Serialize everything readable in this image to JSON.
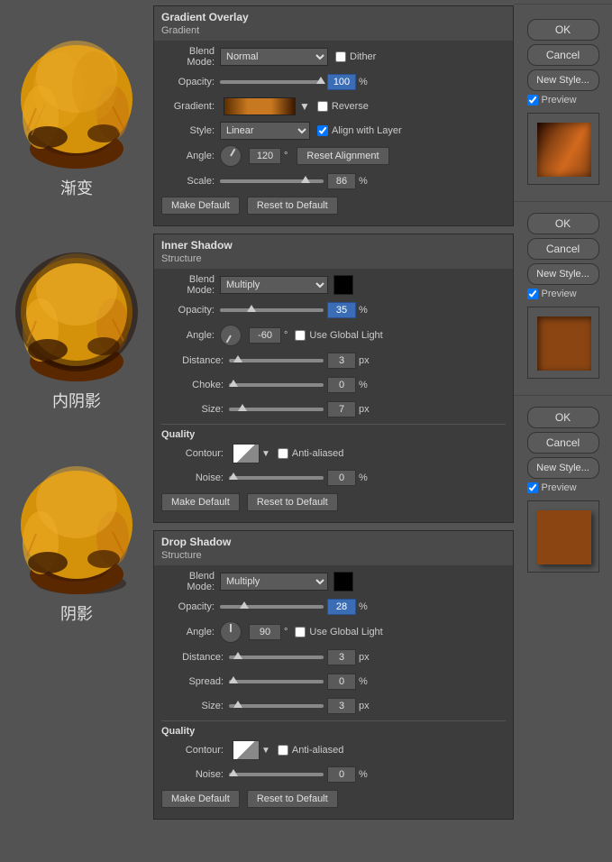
{
  "panels": {
    "gradient_overlay": {
      "title": "Gradient Overlay",
      "subtitle": "Gradient",
      "blend_mode_label": "Blend Mode:",
      "blend_mode_value": "Normal",
      "dither_label": "Dither",
      "opacity_label": "Opacity:",
      "opacity_value": "100",
      "opacity_unit": "%",
      "gradient_label": "Gradient:",
      "reverse_label": "Reverse",
      "style_label": "Style:",
      "style_value": "Linear",
      "align_layer_label": "Align with Layer",
      "angle_label": "Angle:",
      "angle_value": "120",
      "angle_unit": "°",
      "reset_alignment_label": "Reset Alignment",
      "scale_label": "Scale:",
      "scale_value": "86",
      "scale_unit": "%",
      "make_default_label": "Make Default",
      "reset_default_label": "Reset to Default"
    },
    "inner_shadow": {
      "title": "Inner Shadow",
      "subtitle": "Structure",
      "blend_mode_label": "Blend Mode:",
      "blend_mode_value": "Multiply",
      "opacity_label": "Opacity:",
      "opacity_value": "35",
      "opacity_unit": "%",
      "angle_label": "Angle:",
      "angle_value": "-60",
      "angle_unit": "°",
      "use_global_light_label": "Use Global Light",
      "distance_label": "Distance:",
      "distance_value": "3",
      "distance_unit": "px",
      "choke_label": "Choke:",
      "choke_value": "0",
      "choke_unit": "%",
      "size_label": "Size:",
      "size_value": "7",
      "size_unit": "px",
      "quality_title": "Quality",
      "contour_label": "Contour:",
      "anti_aliased_label": "Anti-aliased",
      "noise_label": "Noise:",
      "noise_value": "0",
      "noise_unit": "%",
      "make_default_label": "Make Default",
      "reset_default_label": "Reset to Default"
    },
    "drop_shadow": {
      "title": "Drop Shadow",
      "subtitle": "Structure",
      "blend_mode_label": "Blend Mode:",
      "blend_mode_value": "Multiply",
      "opacity_label": "Opacity:",
      "opacity_value": "28",
      "opacity_unit": "%",
      "angle_label": "Angle:",
      "angle_value": "90",
      "angle_unit": "°",
      "use_global_light_label": "Use Global Light",
      "distance_label": "Distance:",
      "distance_value": "3",
      "distance_unit": "px",
      "spread_label": "Spread:",
      "spread_value": "0",
      "spread_unit": "%",
      "size_label": "Size:",
      "size_value": "3",
      "size_unit": "px",
      "quality_title": "Quality",
      "contour_label": "Contour:",
      "anti_aliased_label": "Anti-aliased",
      "noise_label": "Noise:",
      "noise_value": "0",
      "noise_unit": "%",
      "make_default_label": "Make Default",
      "reset_default_label": "Reset to Default"
    }
  },
  "labels": {
    "gradient_cn": "渐变",
    "inner_shadow_cn": "内阴影",
    "drop_shadow_cn": "阴影"
  },
  "buttons": {
    "ok": "OK",
    "cancel": "Cancel",
    "new_style": "New Style...",
    "preview": "Preview"
  }
}
